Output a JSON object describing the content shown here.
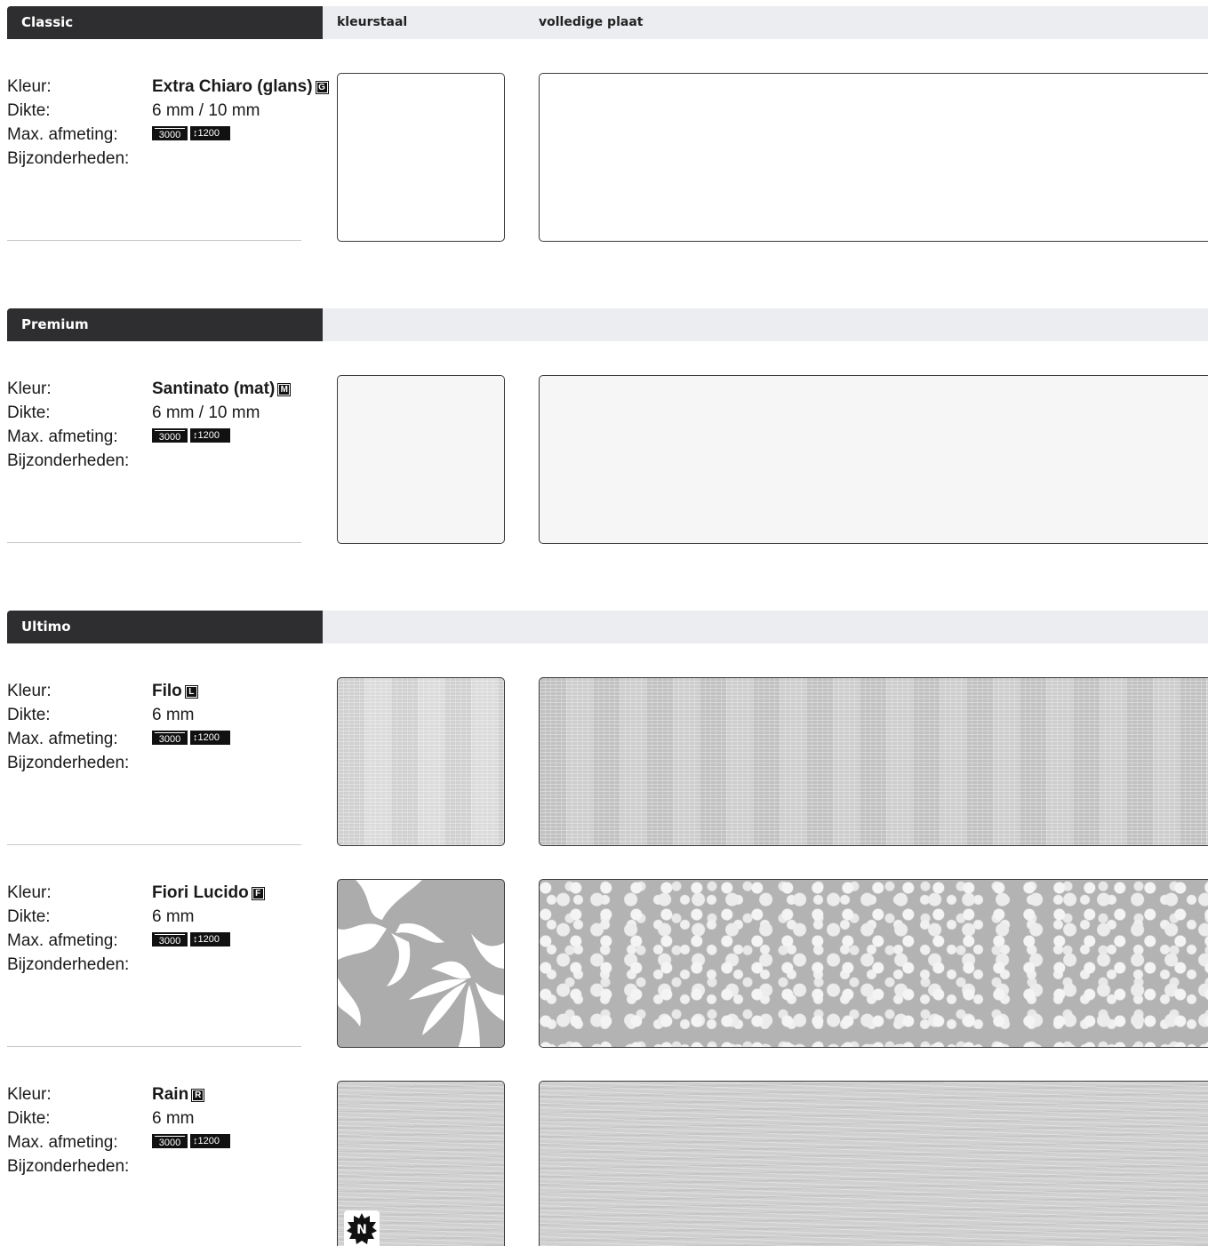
{
  "header": {
    "col_swatch": "kleurstaal",
    "col_full": "volledige plaat"
  },
  "labels": {
    "kleur": "Kleur:",
    "dikte": "Dikte:",
    "afmeting": "Max. afmeting:",
    "bijzonder": "Bijzonderheden:"
  },
  "sections": [
    {
      "title": "Classic",
      "products": [
        {
          "name": "Extra Chiaro (glans)",
          "badge": "G",
          "dikte": "6 mm / 10 mm",
          "width": "3000",
          "height": "1200",
          "texture": "plain",
          "new": false
        }
      ]
    },
    {
      "title": "Premium",
      "products": [
        {
          "name": "Santinato (mat)",
          "badge": "M",
          "dikte": "6 mm / 10 mm",
          "width": "3000",
          "height": "1200",
          "texture": "santinato",
          "new": false
        }
      ]
    },
    {
      "title": "Ultimo",
      "products": [
        {
          "name": "Filo",
          "badge": "L",
          "dikte": "6 mm",
          "width": "3000",
          "height": "1200",
          "texture": "filo",
          "new": false
        },
        {
          "name": "Fiori Lucido",
          "badge": "F",
          "dikte": "6 mm",
          "width": "3000",
          "height": "1200",
          "texture": "fiori",
          "new": false
        },
        {
          "name": "Rain",
          "badge": "R",
          "dikte": "6 mm",
          "width": "3000",
          "height": "1200",
          "texture": "rain",
          "new": true,
          "new_label": "N"
        }
      ]
    }
  ],
  "colors": {
    "header_dark": "#2e2e30",
    "header_band": "#ecedf0",
    "fiori_gray": "#acacac"
  }
}
